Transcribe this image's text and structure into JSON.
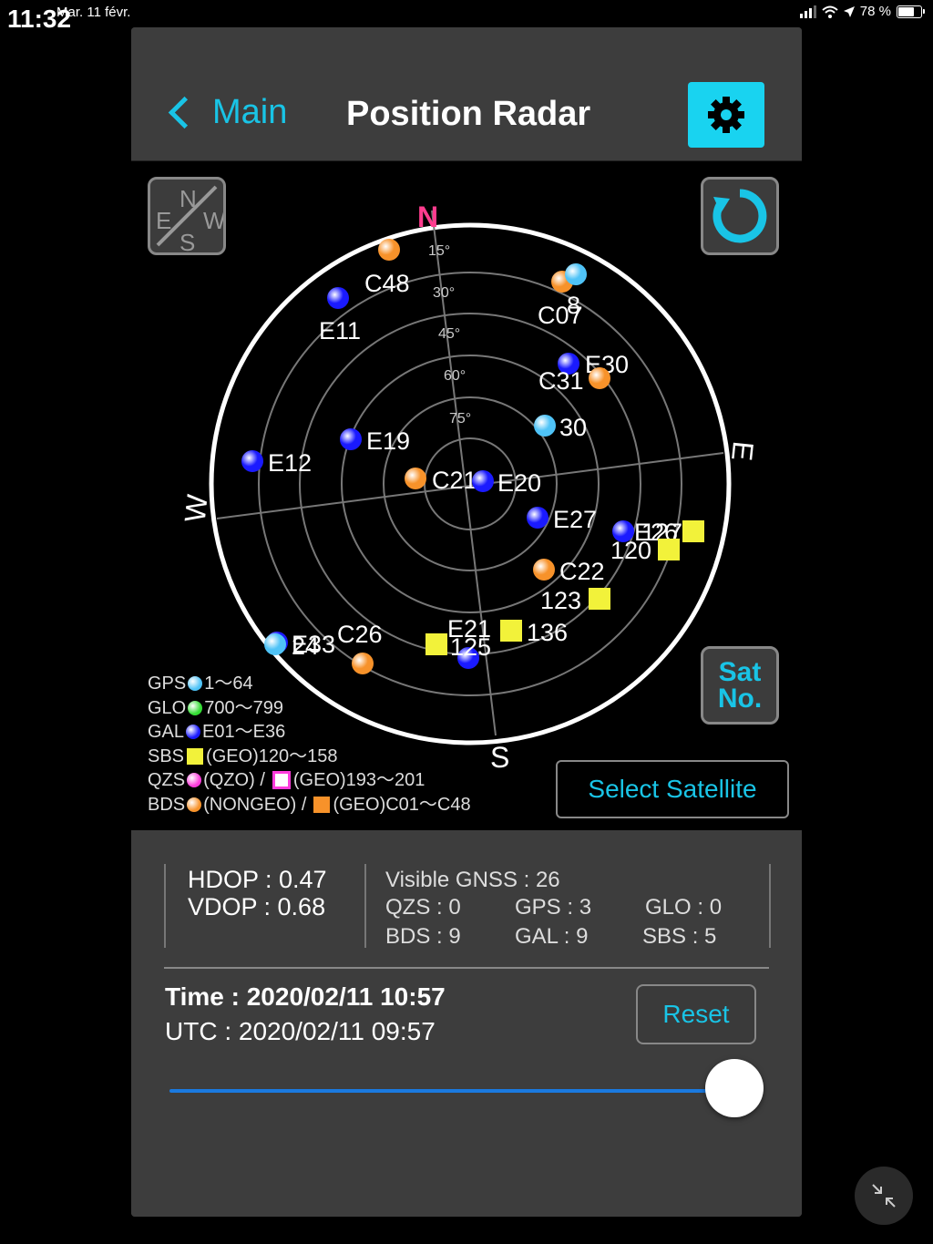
{
  "status_bar": {
    "time": "11:32",
    "date": "Mar. 11 févr.",
    "battery": "78 %",
    "battery_level": 0.78
  },
  "header": {
    "back_label": "Main",
    "title": "Position Radar"
  },
  "radar": {
    "north": "N",
    "east": "E",
    "south": "S",
    "west": "W",
    "elevation_labels": [
      "15°",
      "30°",
      "45°",
      "60°",
      "75°"
    ],
    "reset_orientation_icon": "rotate-icon",
    "compass_icon": "compass-disabled-icon",
    "sat_no_label_line1": "Sat",
    "sat_no_label_line2": "No.",
    "satellites": [
      {
        "id": "C48",
        "system": "BDS",
        "shape": "dot",
        "color": "#f7922a"
      },
      {
        "id": "E11",
        "system": "GAL",
        "shape": "dot",
        "color": "#1a1aff"
      },
      {
        "id": "C07",
        "system": "BDS",
        "shape": "dot",
        "color": "#f7922a"
      },
      {
        "id": "8",
        "system": "GPS",
        "shape": "dot",
        "color": "#4fc3f7"
      },
      {
        "id": "E30",
        "system": "GAL",
        "shape": "dot",
        "color": "#1a1aff"
      },
      {
        "id": "C31",
        "system": "BDS",
        "shape": "dot",
        "color": "#f7922a"
      },
      {
        "id": "30",
        "system": "GPS",
        "shape": "dot",
        "color": "#4fc3f7"
      },
      {
        "id": "E19",
        "system": "GAL",
        "shape": "dot",
        "color": "#1a1aff"
      },
      {
        "id": "E12",
        "system": "GAL",
        "shape": "dot",
        "color": "#1a1aff"
      },
      {
        "id": "C21",
        "system": "BDS",
        "shape": "dot",
        "color": "#f7922a"
      },
      {
        "id": "E20",
        "system": "GAL",
        "shape": "dot",
        "color": "#1a1aff"
      },
      {
        "id": "E27",
        "system": "GAL",
        "shape": "dot",
        "color": "#1a1aff"
      },
      {
        "id": "E26",
        "system": "GAL",
        "shape": "dot",
        "color": "#1a1aff"
      },
      {
        "id": "127",
        "system": "SBS",
        "shape": "square",
        "color": "#f2f23a"
      },
      {
        "id": "120",
        "system": "SBS",
        "shape": "square",
        "color": "#f2f23a"
      },
      {
        "id": "C22",
        "system": "BDS",
        "shape": "dot",
        "color": "#f7922a"
      },
      {
        "id": "123",
        "system": "SBS",
        "shape": "square",
        "color": "#f2f23a"
      },
      {
        "id": "136",
        "system": "SBS",
        "shape": "square",
        "color": "#f2f23a"
      },
      {
        "id": "E21",
        "system": "GAL",
        "shape": "dot",
        "color": "#1a1aff"
      },
      {
        "id": "125",
        "system": "SBS",
        "shape": "square",
        "color": "#f2f23a"
      },
      {
        "id": "C26",
        "system": "BDS",
        "shape": "dot",
        "color": "#f7922a"
      },
      {
        "id": "E33",
        "system": "GAL",
        "shape": "dot",
        "color": "#1a1aff"
      },
      {
        "id": "24",
        "system": "GPS",
        "shape": "dot",
        "color": "#4fc3f7"
      }
    ]
  },
  "legend": {
    "gps": {
      "name": "GPS",
      "range": "1～64",
      "color": "#4fc3f7"
    },
    "glo": {
      "name": "GLO",
      "range": "700～799",
      "color": "#33dd33"
    },
    "gal": {
      "name": "GAL",
      "range": "E01～E36",
      "color": "#1a1aff"
    },
    "sbs": {
      "name": "SBS",
      "range": "(GEO)120～158",
      "color": "#f2f23a"
    },
    "qzs": {
      "name": "QZS",
      "qzo": "(QZO) /",
      "range": "(GEO)193～201",
      "color": "#ff3cdc"
    },
    "bds": {
      "name": "BDS",
      "nongeo": "(NONGEO) /",
      "range": "(GEO)C01～C48",
      "color": "#f7922a"
    }
  },
  "select_satellite_label": "Select Satellite",
  "dop": {
    "hdop": "HDOP : 0.47",
    "vdop": "VDOP : 0.68"
  },
  "gnss_counts": {
    "visible": "Visible GNSS : 26",
    "qzs": "QZS : 0",
    "gps": "GPS : 3",
    "glo": "GLO : 0",
    "bds": "BDS : 9",
    "gal": "GAL : 9",
    "sbs": "SBS : 5"
  },
  "time_label": "Time : 2020/02/11 10:57",
  "utc_label": "UTC : 2020/02/11 09:57",
  "reset_label": "Reset",
  "slider_value": 1.0
}
